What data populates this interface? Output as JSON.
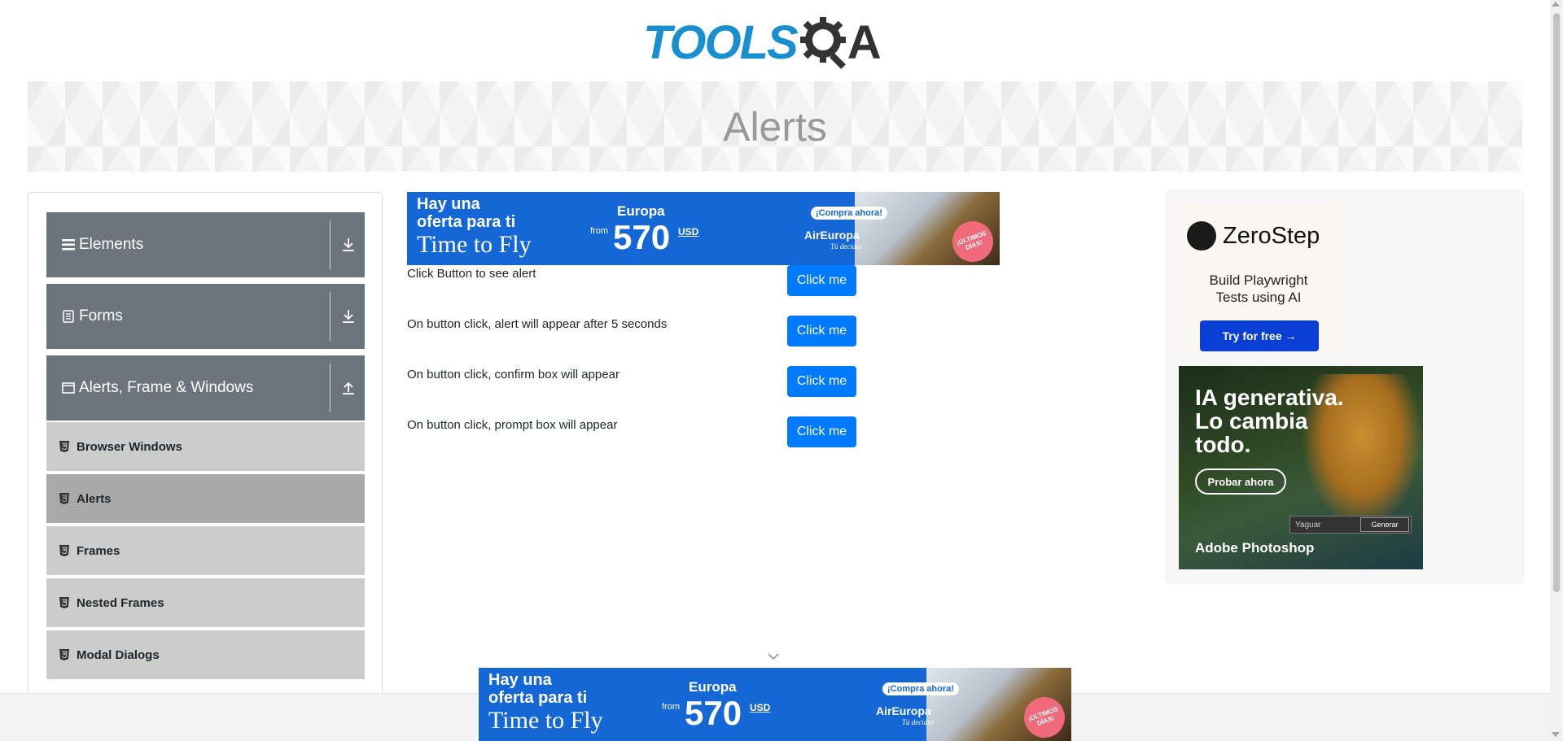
{
  "logo": {
    "tools_text": "TOOLS",
    "qa_text": "A"
  },
  "banner": {
    "title": "Alerts"
  },
  "sidebar": {
    "groups": [
      {
        "label": "Elements",
        "icon": "hamburger-icon",
        "arrow": "download-arrow-icon"
      },
      {
        "label": "Forms",
        "icon": "document-icon",
        "arrow": "download-arrow-icon"
      },
      {
        "label": "Alerts, Frame & Windows",
        "icon": "window-icon",
        "arrow": "upload-arrow-icon"
      }
    ],
    "items": [
      {
        "label": "Browser Windows",
        "active": false
      },
      {
        "label": "Alerts",
        "active": true
      },
      {
        "label": "Frames",
        "active": false
      },
      {
        "label": "Nested Frames",
        "active": false
      },
      {
        "label": "Modal Dialogs",
        "active": false
      }
    ]
  },
  "ad_top": {
    "line1": "Hay una",
    "line2": "oferta para ti",
    "line3": "Time to Fly",
    "region": "Europa",
    "from": "from",
    "price": "570",
    "currency": "USD",
    "cta": "¡Compra ahora!",
    "brand": "AirEuropa",
    "tagline": "Tú decides",
    "badge": "¡ÚLTIMOS DÍAS!"
  },
  "alerts": [
    {
      "label": "Click Button to see alert",
      "button": "Click me"
    },
    {
      "label": "On button click, alert will appear after 5 seconds",
      "button": "Click me"
    },
    {
      "label": "On button click, confirm box will appear",
      "button": "Click me"
    },
    {
      "label": "On button click, prompt box will appear",
      "button": "Click me"
    }
  ],
  "right_ad": {
    "zerostep": {
      "name": "ZeroStep",
      "subtitle_line1": "Build Playwright",
      "subtitle_line2": "Tests using AI",
      "button": "Try for free →"
    },
    "photoshop": {
      "title_line1": "IA generativa.",
      "title_line2": "Lo cambia",
      "title_line3": "todo.",
      "button": "Probar ahora",
      "input_value": "Yaguar",
      "generate": "Generar",
      "brand": "Adobe Photoshop"
    }
  },
  "colors": {
    "primary_button": "#007bff",
    "sidebar_group": "#6c757d",
    "sidebar_item": "#cccccc",
    "sidebar_item_active": "#a9a9a9",
    "logo_blue": "#1a8fd0"
  }
}
